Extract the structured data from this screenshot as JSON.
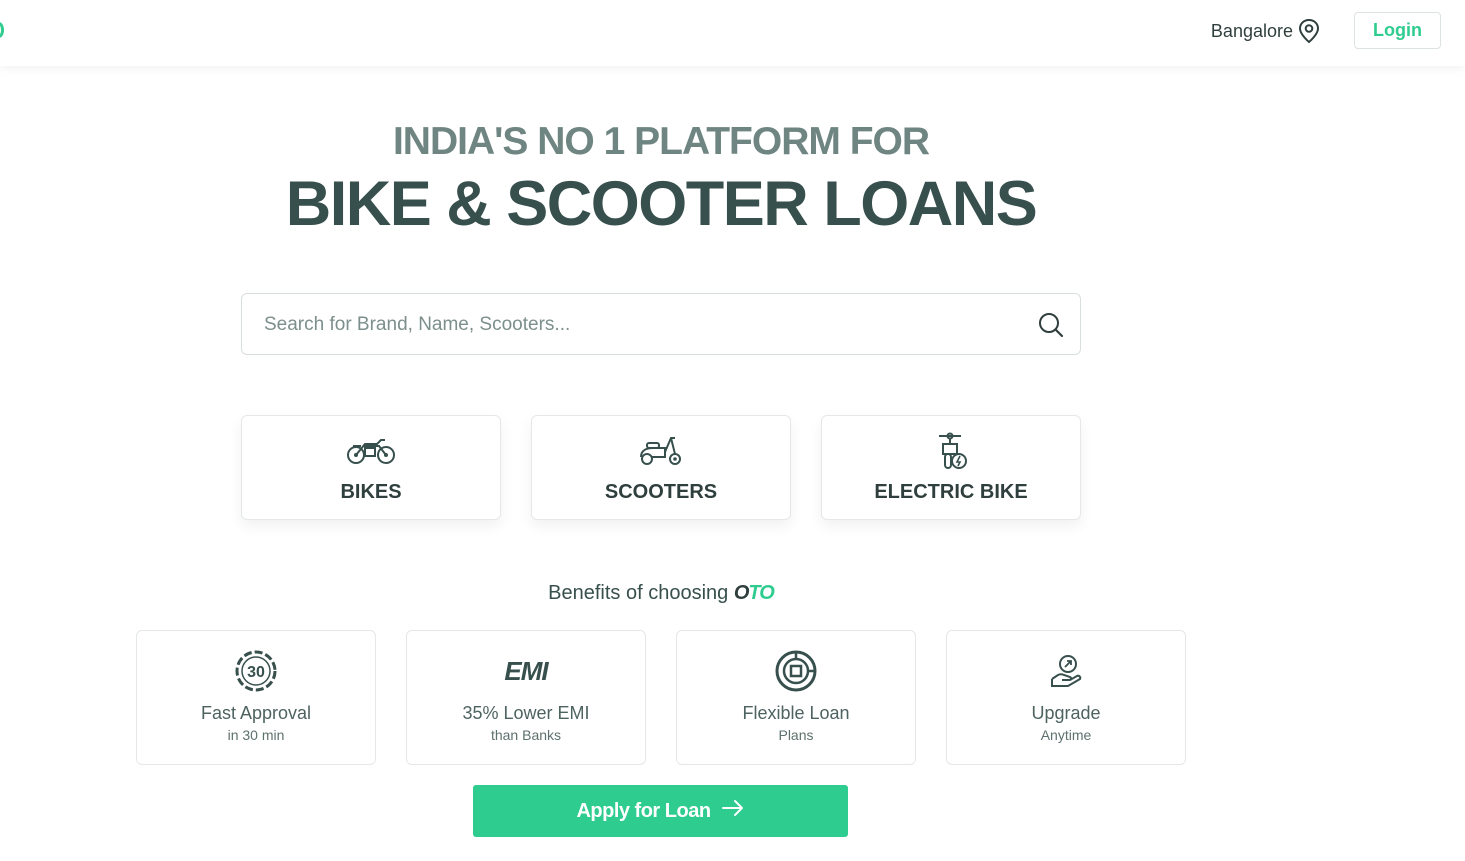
{
  "header": {
    "location": "Bangalore",
    "login_label": "Login"
  },
  "hero": {
    "subtitle": "INDIA'S NO 1 PLATFORM FOR",
    "title": "BIKE & SCOOTER LOANS"
  },
  "search": {
    "placeholder": "Search for Brand, Name, Scooters..."
  },
  "categories": [
    {
      "label": "BIKES",
      "icon": "motorcycle-icon"
    },
    {
      "label": "SCOOTERS",
      "icon": "scooter-icon"
    },
    {
      "label": "ELECTRIC BIKE",
      "icon": "electric-bike-icon"
    }
  ],
  "benefits": {
    "heading": "Benefits of choosing",
    "brand_o": "O",
    "brand_to": "TO",
    "items": [
      {
        "title": "Fast Approval",
        "subtitle": "in 30 min",
        "icon": "clock-30-icon"
      },
      {
        "title": "35% Lower EMI",
        "subtitle": "than Banks",
        "icon": "emi-icon",
        "icon_text": "EMI"
      },
      {
        "title": "Flexible Loan",
        "subtitle": "Plans",
        "icon": "flexible-plan-icon"
      },
      {
        "title": "Upgrade",
        "subtitle": "Anytime",
        "icon": "upgrade-hand-icon"
      }
    ]
  },
  "cta": {
    "apply_label": "Apply for Loan"
  },
  "colors": {
    "accent": "#2ecc8f",
    "text_dark": "#37504d",
    "text_muted": "#6f8582"
  }
}
